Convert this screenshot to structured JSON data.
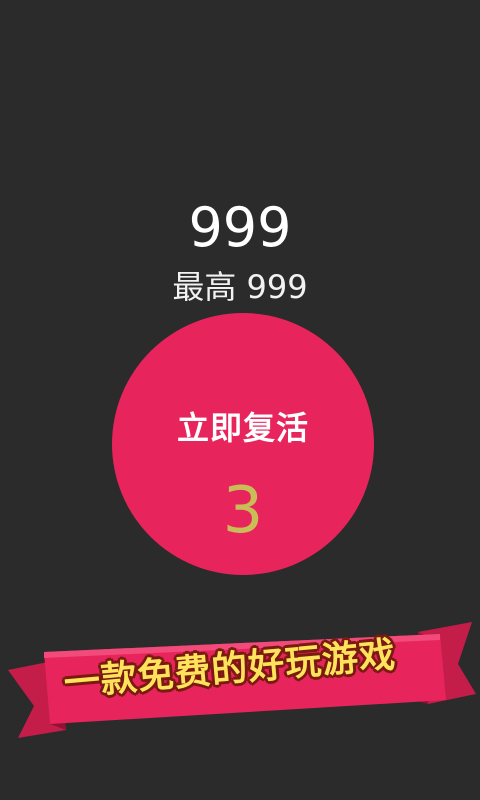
{
  "game": {
    "score": "999",
    "best_label": "最高 999"
  },
  "revive": {
    "label": "立即复活",
    "countdown": "3"
  },
  "banner": {
    "text": "一款免费的好玩游戏"
  },
  "colors": {
    "background": "#2b2b2b",
    "circle": "#e8245c",
    "countdown": "#c9bd58",
    "banner": "#e8245c",
    "banner_text": "#ffe35a"
  }
}
